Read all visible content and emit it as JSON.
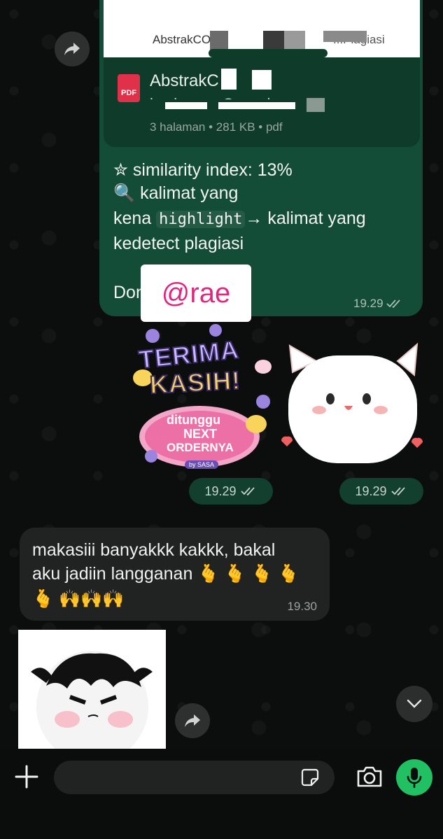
{
  "shared_doc": {
    "preview_caption": "AbstrakCO",
    "preview_caption_right": "...Plagiasi",
    "file_icon_label": "PDF",
    "title": "AbstrakC",
    "subtitle": "kasiyya ... Cegesi ...",
    "meta": "3 halaman • 281 KB • pdf"
  },
  "outgoing_message": {
    "line1": "✮  similarity index: 13%",
    "line2": "🔍 kalimat yang",
    "line3_prefix": "kena ",
    "line3_code": "highlight",
    "line3_suffix": "→ kalimat yang",
    "line4": "kedetect plagiasi",
    "line5": "Done kak💞",
    "watermark": "@rae",
    "time": "19.29"
  },
  "sticker_times": [
    "19.29",
    "19.29"
  ],
  "sticker_terima": {
    "line1": "TERIMA",
    "line2": "KASIH!",
    "line3": "ditunggu",
    "line4": "NEXT",
    "line5": "ORDERNYA",
    "credit": "by SASA"
  },
  "incoming_message": {
    "line1": "makasiii banyakkk kakkk, bakal",
    "line2": "aku jadiin langganan 🫰 🫰 🫰 🫰",
    "line3": "🫰 🙌🙌🙌",
    "time": "19.30"
  },
  "composer": {
    "placeholder": ""
  },
  "icons": {
    "forward": "forward-arrow-icon",
    "add": "plus-icon",
    "sticker": "sticker-icon",
    "camera": "camera-icon",
    "mic": "microphone-icon",
    "scroll": "chevron-down-icon",
    "read_receipt": "double-check-icon"
  },
  "colors": {
    "accent": "#21c063",
    "outgoing_bubble": "#144d37",
    "incoming_bubble": "#202322",
    "watermark": "#e3257f"
  }
}
